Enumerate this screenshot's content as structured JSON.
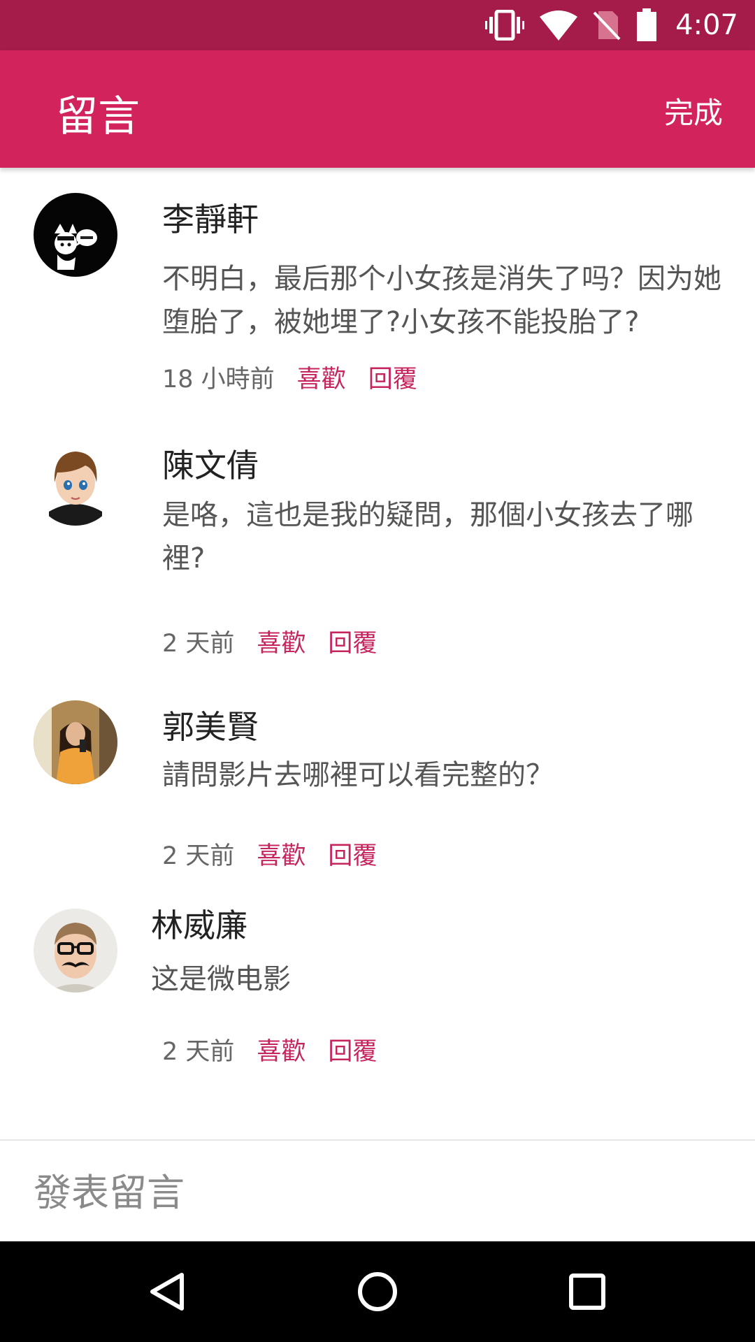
{
  "status_bar": {
    "time": "4:07",
    "icons": [
      "vibrate-icon",
      "wifi-icon",
      "no-sim-icon",
      "battery-icon"
    ]
  },
  "app_bar": {
    "title": "留言",
    "done_label": "完成"
  },
  "colors": {
    "status_bar": "#a51b49",
    "app_bar": "#d2235c",
    "accent": "#c5245c",
    "nav_bar": "#000000"
  },
  "comments": [
    {
      "author": "李靜軒",
      "body": "不明白，最后那个小女孩是消失了吗？因为她堕胎了，被她埋了?小女孩不能投胎了?",
      "time": "18 小時前",
      "like_label": "喜歡",
      "reply_label": "回覆"
    },
    {
      "author": "陳文倩",
      "body": "是咯，這也是我的疑問，那個小女孩去了哪裡?",
      "time": "2 天前",
      "like_label": "喜歡",
      "reply_label": "回覆"
    },
    {
      "author": "郭美賢",
      "body": "請問影片去哪裡可以看完整的？",
      "time": "2 天前",
      "like_label": "喜歡",
      "reply_label": "回覆"
    },
    {
      "author": "林威廉",
      "body": "这是微电影",
      "time": "2 天前",
      "like_label": "喜歡",
      "reply_label": "回覆"
    }
  ],
  "compose": {
    "placeholder": "發表留言"
  },
  "nav_bar": {
    "icons": [
      "back-icon",
      "home-icon",
      "recents-icon"
    ]
  }
}
